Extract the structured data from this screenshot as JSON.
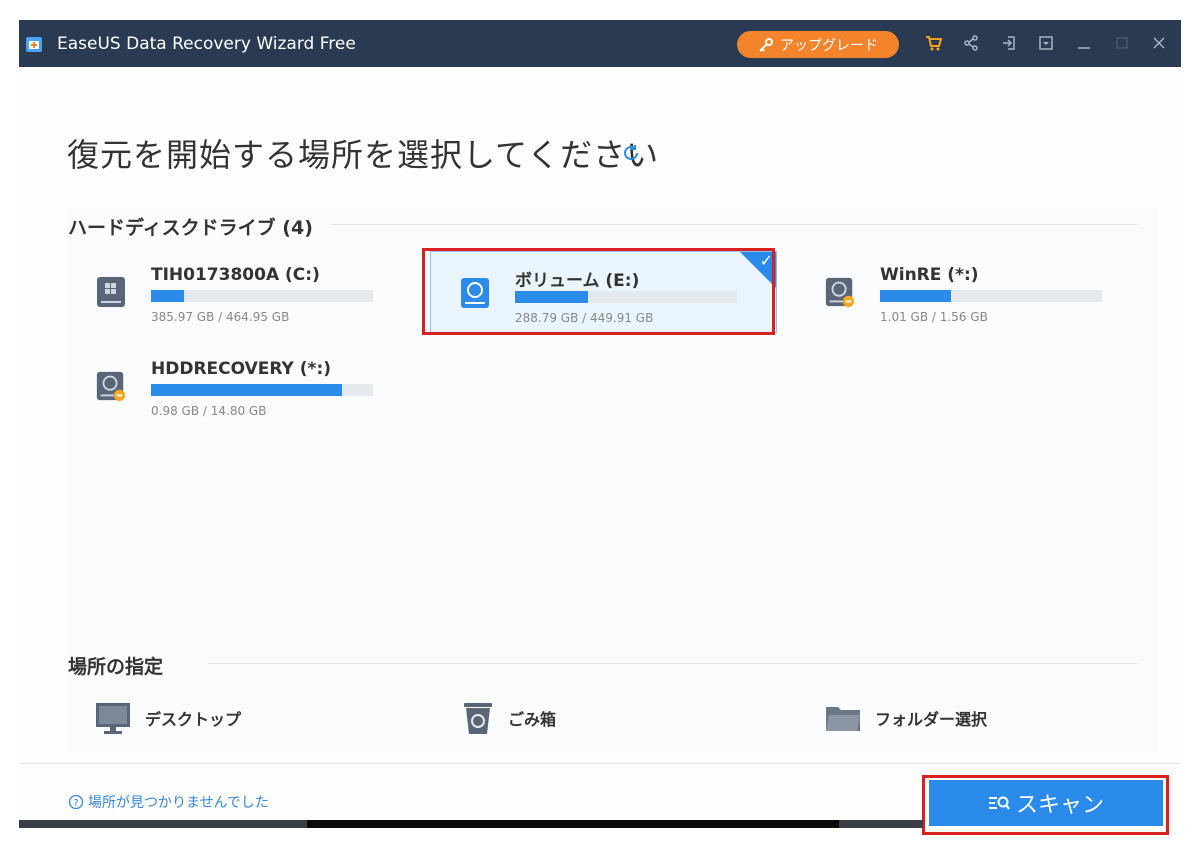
{
  "window": {
    "title": "EaseUS Data Recovery Wizard Free",
    "upgrade_label": "アップグレード",
    "icons": [
      "cart-icon",
      "share-icon",
      "sign-in-icon",
      "dropdown-menu-icon",
      "minimize-icon",
      "maximize-icon",
      "close-icon"
    ]
  },
  "main": {
    "heading": "復元を開始する場所を選択してください"
  },
  "hard_drives": {
    "section_title": "ハードディスクドライブ (4)",
    "drives": [
      {
        "name": "TIH0173800A (C:)",
        "size": "385.97 GB / 464.95 GB",
        "used_fraction": 0.15,
        "icon": "windows-drive-icon"
      },
      {
        "name": "ボリューム (E:)",
        "size": "288.79 GB / 449.91 GB",
        "used_fraction": 0.33,
        "icon": "drive-icon",
        "selected": true
      },
      {
        "name": "WinRE (*:)",
        "size": "1.01 GB / 1.56 GB",
        "used_fraction": 0.32,
        "icon": "drive-warning-icon"
      },
      {
        "name": "HDDRECOVERY (*:)",
        "size": "0.98 GB / 14.80 GB",
        "used_fraction": 0.86,
        "icon": "drive-warning-icon"
      }
    ]
  },
  "locations": {
    "section_title": "場所の指定",
    "items": [
      {
        "label": "デスクトップ",
        "icon": "monitor-icon"
      },
      {
        "label": "ごみ箱",
        "icon": "recycle-bin-icon"
      },
      {
        "label": "フォルダー選択",
        "icon": "folder-icon"
      }
    ]
  },
  "footer": {
    "help_text": "場所が見つかりませんでした",
    "scan_label": "スキャン"
  },
  "colors": {
    "titlebar": "#2a3a52",
    "accent": "#2b8bea",
    "upgrade": "#f4842c",
    "highlight_box": "#d92020"
  }
}
